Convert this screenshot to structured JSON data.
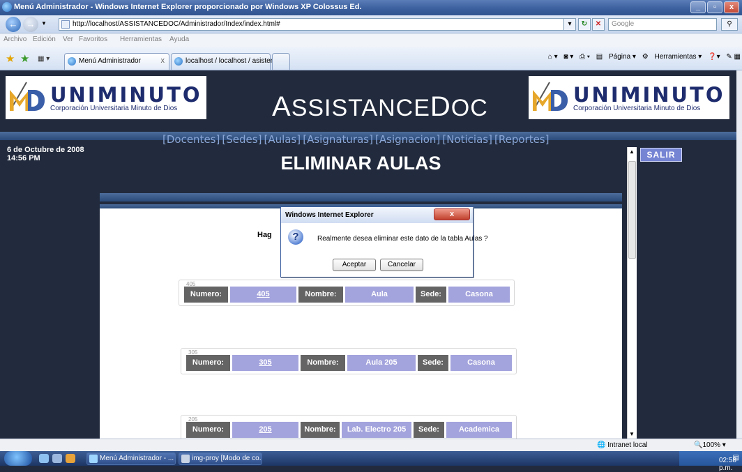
{
  "window": {
    "title": "Menú Administrador - Windows Internet Explorer proporcionado por Windows XP Colossus Ed."
  },
  "address": {
    "url": "http://localhost/ASSISTANCEDOC/Administrador/Index/index.html#",
    "search_placeholder": "Google"
  },
  "menu": [
    "Archivo",
    "Edición",
    "Ver",
    "Favoritos",
    "Herramientas",
    "Ayuda"
  ],
  "tabs": [
    {
      "label": "Menú Administrador",
      "active": true
    },
    {
      "label": "localhost / localhost / asisten...",
      "active": false
    }
  ],
  "commandbar": {
    "page": "Página",
    "tools": "Herramientas"
  },
  "banner": {
    "logo_word": "UNIMINUTO",
    "logo_sub": "Corporación Universitaria Minuto de Dios",
    "app_title_a": "A",
    "app_title_b": "SSISTANCE",
    "app_title_c": "D",
    "app_title_d": "OC"
  },
  "nav": [
    "[Docentes]",
    "[Sedes]",
    "[Aulas]",
    "[Asignaturas]",
    "[Asignacion]",
    "[Noticias]",
    "[Reportes]"
  ],
  "date": {
    "line1": "6 de Octubre de 2008",
    "line2": "14:56 PM"
  },
  "page": {
    "title": "ELIMINAR AULAS",
    "partial_text": "Hag",
    "salir": "SALIR"
  },
  "labels": {
    "numero": "Numero:",
    "nombre": "Nombre:",
    "sede": "Sede:"
  },
  "records": [
    {
      "id": "405",
      "numero": "405",
      "nombre": "Aula",
      "sede": "Casona"
    },
    {
      "id": "305",
      "numero": "305",
      "nombre": "Aula 205",
      "sede": "Casona"
    },
    {
      "id": "205",
      "numero": "205",
      "nombre": "Lab. Electro 205",
      "sede": "Academica"
    }
  ],
  "dialog": {
    "title": "Windows Internet Explorer",
    "message": "Realmente desea eliminar este dato de la tabla Aulas ?",
    "ok": "Aceptar",
    "cancel": "Cancelar"
  },
  "status": {
    "zone": "Intranet local",
    "zoom": "100%"
  },
  "taskbar": {
    "items": [
      "Menú Administrador - ...",
      "img-proy [Modo de co..."
    ],
    "clock": "02:58 p.m."
  }
}
